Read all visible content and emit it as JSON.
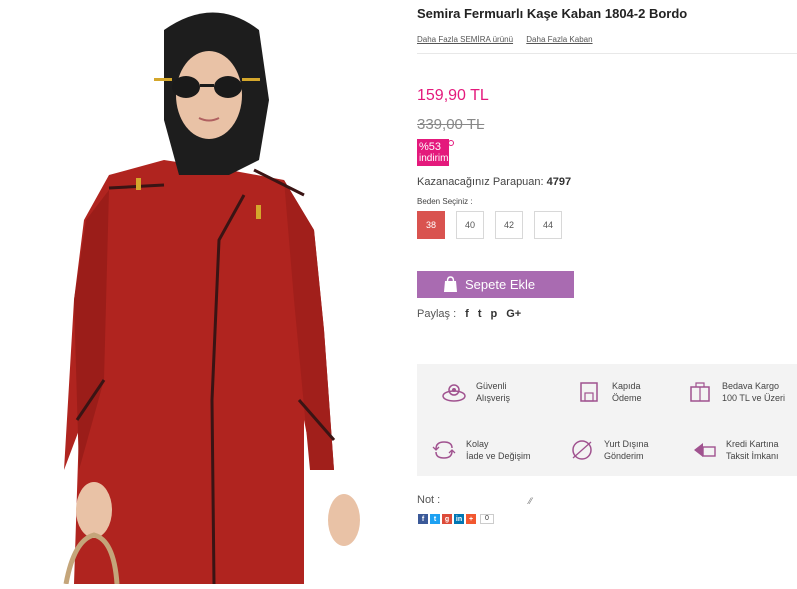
{
  "product": {
    "title": "Semira Fermuarlı Kaşe Kaban 1804-2 Bordo",
    "link_brand": "Daha Fazla SEMİRA ürünü",
    "link_category": "Daha Fazla Kaban",
    "price": "159,90 TL",
    "old_price": "339,00 TL",
    "discount_pct": "%53",
    "discount_label": "indirim",
    "points_label": "Kazanacağınız Parapuan:",
    "points_value": "4797",
    "size_label": "Beden Seçiniz :",
    "sizes": [
      "38",
      "40",
      "42",
      "44"
    ],
    "selected_size": "38",
    "cart_label": "Sepete Ekle",
    "share_label": "Paylaş :",
    "share_icons": [
      "f",
      "t",
      "p",
      "G+"
    ]
  },
  "features": [
    {
      "icon": "secure-shopping-icon",
      "line1": "Güvenli",
      "line2": "Alışveriş"
    },
    {
      "icon": "pay-at-door-icon",
      "line1": "Kapıda",
      "line2": "Ödeme"
    },
    {
      "icon": "free-shipping-icon",
      "line1": "Bedava Kargo",
      "line2": "100 TL  ve Üzeri"
    },
    {
      "icon": "easy-return-icon",
      "line1": "Kolay",
      "line2": "İade ve Değişim"
    },
    {
      "icon": "international-shipping-icon",
      "line1": "Yurt Dışına",
      "line2": "Gönderim"
    },
    {
      "icon": "credit-card-icon",
      "line1": "Kredi Kartına",
      "line2": "Taksit İmkanı"
    }
  ],
  "note": {
    "label": "Not :"
  },
  "social": {
    "count": "0"
  },
  "colors": {
    "accent": "#e4197c",
    "cart": "#a96bb1",
    "size_active": "#d9534f",
    "icon": "#a0528f"
  }
}
